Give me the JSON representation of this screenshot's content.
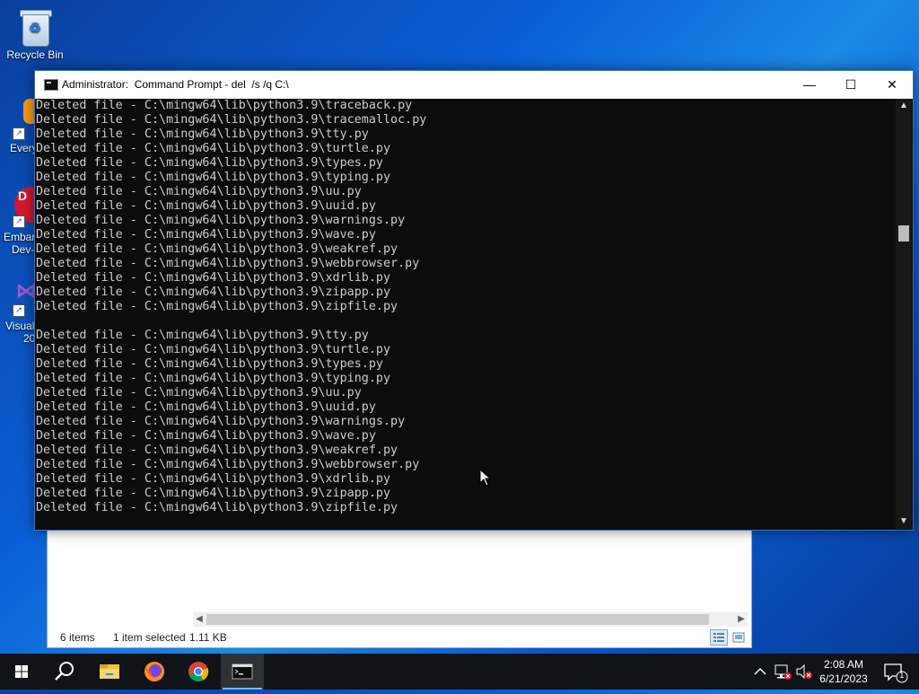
{
  "desktop": {
    "icons": [
      {
        "label": "Recycle Bin",
        "icon": "recycle-bin-icon"
      },
      {
        "label": "Every",
        "icon": "everything-icon"
      },
      {
        "label": "Embar",
        "label2": "Dev-",
        "icon": "embarcadero-icon"
      },
      {
        "label": "Visual",
        "label2": "20",
        "icon": "visual-studio-icon"
      }
    ]
  },
  "cmd_window": {
    "title": "Administrator:  Command Prompt - del  /s /q C:\\",
    "buttons": {
      "minimize": "—",
      "maximize": "☐",
      "close": "✕"
    },
    "lines": [
      "Deleted file - C:\\mingw64\\lib\\python3.9\\traceback.py",
      "Deleted file - C:\\mingw64\\lib\\python3.9\\tracemalloc.py",
      "Deleted file - C:\\mingw64\\lib\\python3.9\\tty.py",
      "Deleted file - C:\\mingw64\\lib\\python3.9\\turtle.py",
      "Deleted file - C:\\mingw64\\lib\\python3.9\\types.py",
      "Deleted file - C:\\mingw64\\lib\\python3.9\\typing.py",
      "Deleted file - C:\\mingw64\\lib\\python3.9\\uu.py",
      "Deleted file - C:\\mingw64\\lib\\python3.9\\uuid.py",
      "Deleted file - C:\\mingw64\\lib\\python3.9\\warnings.py",
      "Deleted file - C:\\mingw64\\lib\\python3.9\\wave.py",
      "Deleted file - C:\\mingw64\\lib\\python3.9\\weakref.py",
      "Deleted file - C:\\mingw64\\lib\\python3.9\\webbrowser.py",
      "Deleted file - C:\\mingw64\\lib\\python3.9\\xdrlib.py",
      "Deleted file - C:\\mingw64\\lib\\python3.9\\zipapp.py",
      "Deleted file - C:\\mingw64\\lib\\python3.9\\zipfile.py",
      "",
      "Deleted file - C:\\mingw64\\lib\\python3.9\\tty.py",
      "Deleted file - C:\\mingw64\\lib\\python3.9\\turtle.py",
      "Deleted file - C:\\mingw64\\lib\\python3.9\\types.py",
      "Deleted file - C:\\mingw64\\lib\\python3.9\\typing.py",
      "Deleted file - C:\\mingw64\\lib\\python3.9\\uu.py",
      "Deleted file - C:\\mingw64\\lib\\python3.9\\uuid.py",
      "Deleted file - C:\\mingw64\\lib\\python3.9\\warnings.py",
      "Deleted file - C:\\mingw64\\lib\\python3.9\\wave.py",
      "Deleted file - C:\\mingw64\\lib\\python3.9\\weakref.py",
      "Deleted file - C:\\mingw64\\lib\\python3.9\\webbrowser.py",
      "Deleted file - C:\\mingw64\\lib\\python3.9\\xdrlib.py",
      "Deleted file - C:\\mingw64\\lib\\python3.9\\zipapp.py",
      "Deleted file - C:\\mingw64\\lib\\python3.9\\zipfile.py"
    ]
  },
  "explorer_window": {
    "status_items": "6 items",
    "status_selected": "1 item selected",
    "status_size": "1.11 KB"
  },
  "taskbar": {
    "apps": [
      "windows-start-icon",
      "search-icon",
      "file-explorer-icon",
      "firefox-icon",
      "chrome-icon",
      "command-prompt-icon"
    ],
    "time": "2:08 AM",
    "date": "6/21/2023",
    "notification_count": "1"
  },
  "colors": {
    "console_bg": "#0c0c0c",
    "console_text": "#cccccc",
    "taskbar_bg": "#101317",
    "accent": "#76b9ed"
  }
}
